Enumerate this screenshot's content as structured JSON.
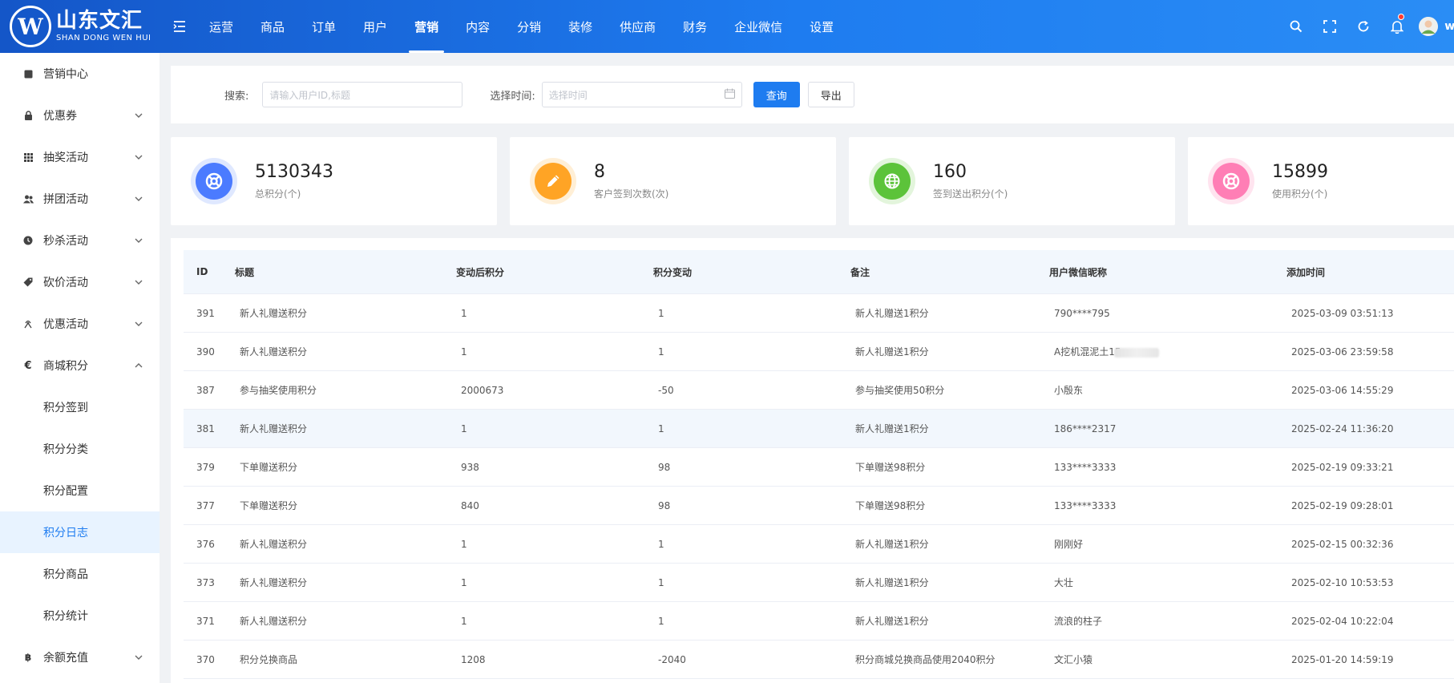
{
  "brand": {
    "mark": "W",
    "name_cn": "山东文汇",
    "name_en": "SHAN DONG WEN HUI"
  },
  "nav": [
    {
      "label": "运营",
      "active": false
    },
    {
      "label": "商品",
      "active": false
    },
    {
      "label": "订单",
      "active": false
    },
    {
      "label": "用户",
      "active": false
    },
    {
      "label": "营销",
      "active": true
    },
    {
      "label": "内容",
      "active": false
    },
    {
      "label": "分销",
      "active": false
    },
    {
      "label": "装修",
      "active": false
    },
    {
      "label": "供应商",
      "active": false
    },
    {
      "label": "财务",
      "active": false
    },
    {
      "label": "企业微信",
      "active": false
    },
    {
      "label": "设置",
      "active": false
    }
  ],
  "header_tools": {
    "icons": [
      "search-icon",
      "fullscreen-icon",
      "refresh-icon",
      "bell-icon"
    ],
    "username": "wi"
  },
  "sidebar": {
    "items": [
      {
        "label": "营销中心",
        "icon": "square-icon"
      },
      {
        "label": "优惠券",
        "icon": "lock-icon",
        "chevron": "down"
      },
      {
        "label": "抽奖活动",
        "icon": "grid-icon",
        "chevron": "down"
      },
      {
        "label": "拼团活动",
        "icon": "users-icon",
        "chevron": "down"
      },
      {
        "label": "秒杀活动",
        "icon": "clock-icon",
        "chevron": "down"
      },
      {
        "label": "砍价活动",
        "icon": "tag-icon",
        "chevron": "down"
      },
      {
        "label": "优惠活动",
        "icon": "gift-icon",
        "chevron": "down"
      },
      {
        "label": "商城积分",
        "icon": "euro-icon",
        "chevron": "up"
      }
    ],
    "sub_items": [
      {
        "label": "积分签到",
        "active": false
      },
      {
        "label": "积分分类",
        "active": false
      },
      {
        "label": "积分配置",
        "active": false
      },
      {
        "label": "积分日志",
        "active": true
      },
      {
        "label": "积分商品",
        "active": false
      },
      {
        "label": "积分统计",
        "active": false
      }
    ],
    "last_item": {
      "label": "余额充值",
      "icon": "bitcoin-icon",
      "chevron": "down"
    }
  },
  "search": {
    "label": "搜索:",
    "placeholder": "请输入用户ID,标题",
    "time_label": "选择时间:",
    "time_placeholder": "选择时间",
    "query_button": "查询",
    "export_button": "导出"
  },
  "stats": [
    {
      "value": "5130343",
      "label": "总积分(个)",
      "color": "#4b7bff",
      "ring": "#dfe8ff",
      "icon": "lifebuoy-icon"
    },
    {
      "value": "8",
      "label": "客户签到次数(次)",
      "color": "#ffa425",
      "ring": "#ffefd6",
      "icon": "pencil-icon"
    },
    {
      "value": "160",
      "label": "签到送出积分(个)",
      "color": "#5cc33a",
      "ring": "#e3f5dc",
      "icon": "globe-icon"
    },
    {
      "value": "15899",
      "label": "使用积分(个)",
      "color": "#ff7eb5",
      "ring": "#ffe4ef",
      "icon": "lifebuoy-icon"
    }
  ],
  "table": {
    "headers": {
      "id": "ID",
      "title": "标题",
      "after": "变动后积分",
      "change": "积分变动",
      "note": "备注",
      "nick": "用户微信昵称",
      "time": "添加时间"
    },
    "rows": [
      {
        "id": "391",
        "title": "新人礼赠送积分",
        "after": "1",
        "change": "1",
        "note": "新人礼赠送1积分",
        "nick": "790****795",
        "time": "2025-03-09 03:51:13"
      },
      {
        "id": "390",
        "title": "新人礼赠送积分",
        "after": "1",
        "change": "1",
        "note": "新人礼赠送1积分",
        "nick": "A挖机混泥土15",
        "time": "2025-03-06 23:59:58"
      },
      {
        "id": "387",
        "title": "参与抽奖使用积分",
        "after": "2000673",
        "change": "-50",
        "note": "参与抽奖使用50积分",
        "nick": "小殷东",
        "time": "2025-03-06 14:55:29"
      },
      {
        "id": "381",
        "title": "新人礼赠送积分",
        "after": "1",
        "change": "1",
        "note": "新人礼赠送1积分",
        "nick": "186****2317",
        "time": "2025-02-24 11:36:20"
      },
      {
        "id": "379",
        "title": "下单赠送积分",
        "after": "938",
        "change": "98",
        "note": "下单赠送98积分",
        "nick": "133****3333",
        "time": "2025-02-19 09:33:21"
      },
      {
        "id": "377",
        "title": "下单赠送积分",
        "after": "840",
        "change": "98",
        "note": "下单赠送98积分",
        "nick": "133****3333",
        "time": "2025-02-19 09:28:01"
      },
      {
        "id": "376",
        "title": "新人礼赠送积分",
        "after": "1",
        "change": "1",
        "note": "新人礼赠送1积分",
        "nick": "刚刚好",
        "time": "2025-02-15 00:32:36"
      },
      {
        "id": "373",
        "title": "新人礼赠送积分",
        "after": "1",
        "change": "1",
        "note": "新人礼赠送1积分",
        "nick": "大壮",
        "time": "2025-02-10 10:53:53"
      },
      {
        "id": "371",
        "title": "新人礼赠送积分",
        "after": "1",
        "change": "1",
        "note": "新人礼赠送1积分",
        "nick": "流浪的柱子",
        "time": "2025-02-04 10:22:04"
      },
      {
        "id": "370",
        "title": "积分兑换商品",
        "after": "1208",
        "change": "-2040",
        "note": "积分商城兑换商品使用2040积分",
        "nick": "文汇小猿",
        "time": "2025-01-20 14:59:19"
      }
    ]
  }
}
